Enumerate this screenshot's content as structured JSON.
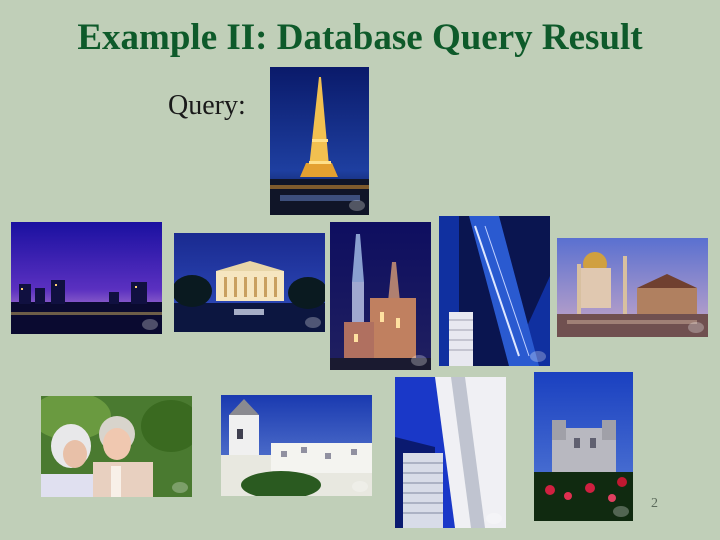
{
  "slide": {
    "title": "Example II: Database Query Result",
    "query_label": "Query:",
    "page_number": "2"
  },
  "images": {
    "query": "eiffel-tower-night-photo",
    "results": [
      "city-skyline-dusk-photo",
      "white-house-night-photo",
      "castle-night-photo",
      "glass-tower-photo",
      "mosque-dusk-photo",
      "elderly-couple-photo",
      "windmill-village-photo",
      "skyscraper-photo",
      "stone-manor-photo"
    ]
  },
  "colors": {
    "background": "#c0cfb8",
    "title": "#0e5a2a"
  }
}
